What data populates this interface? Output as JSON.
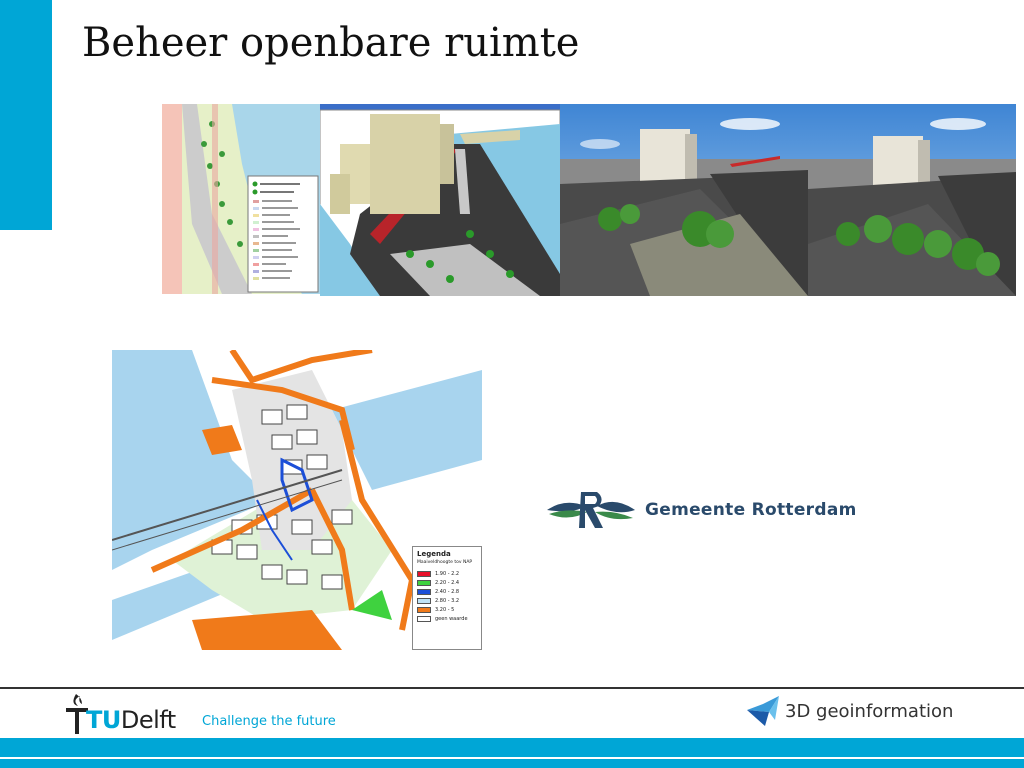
{
  "slide": {
    "title": "Beheer openbare ruimte"
  },
  "images": {
    "map_2d": {
      "icon": "gis-map-image"
    },
    "model_3d": {
      "icon": "3d-city-model-image"
    },
    "render_a": {
      "icon": "3d-render-image"
    },
    "render_b": {
      "icon": "3d-render-image"
    },
    "street_map": {
      "icon": "street-map-image"
    }
  },
  "legend": {
    "title": "Legenda",
    "subtitle": "Maaiveldhoogte tov NAP",
    "rows": [
      {
        "label": "1.90 - 2.2",
        "color": "#e8102a"
      },
      {
        "label": "2.20 - 2.4",
        "color": "#3fd23f"
      },
      {
        "label": "2.40 - 2.8",
        "color": "#1c4fd8"
      },
      {
        "label": "2.80 - 3.2",
        "color": "#bfe3f7"
      },
      {
        "label": "3.20 - 5",
        "color": "#f07a1a"
      },
      {
        "label": "geen waarde",
        "color": "#ffffff"
      }
    ]
  },
  "logos": {
    "rotterdam": "Gemeente Rotterdam",
    "tudelft_tu": "TU",
    "tudelft_delft": "Delft",
    "tagline": "Challenge the future",
    "geoinfo": "3D geoinformation"
  },
  "colors": {
    "accent": "#00a6d6",
    "rotterdam_text": "#2a4a6b",
    "water": "#a8d4ee",
    "building_orange": "#f07a1a"
  }
}
